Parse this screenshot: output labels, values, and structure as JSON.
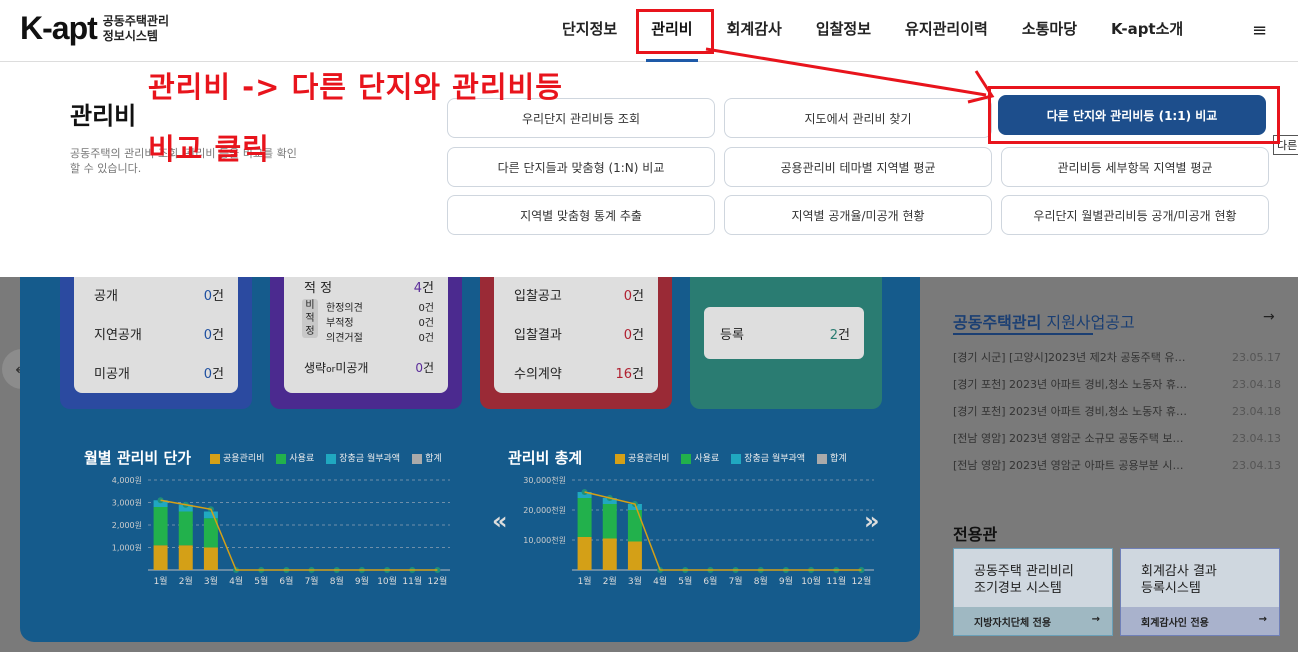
{
  "header": {
    "logo_main": "K-apt",
    "logo_sub1": "공동주택관리",
    "logo_sub2": "정보시스템",
    "nav": [
      "단지정보",
      "관리비",
      "회계감사",
      "입찰정보",
      "유지관리이력",
      "소통마당",
      "K-apt소개"
    ],
    "menu_icon": "≡"
  },
  "mega_menu": {
    "title": "관리비",
    "description": "공동주택의 관리비 조회, 관리비 등을 비교를 확인 할 수 있습니다.",
    "buttons": [
      "우리단지 관리비등 조회",
      "지도에서 관리비 찾기",
      "다른 단지와 관리비등 (1:1) 비교",
      "다른 단지들과 맞춤형 (1:N) 비교",
      "공용관리비 테마별 지역별 평균",
      "관리비등 세부항목 지역별 평균",
      "지역별 맞춤형 통계 추출",
      "지역별 공개율/미공개 현황",
      "우리단지 월별관리비등 공개/미공개 현황"
    ],
    "tooltip": "다른"
  },
  "annotation": {
    "line1": "관리비 -> 다른 단지와 관리비등",
    "line2": "비교 클릭",
    "color": "#e8141c"
  },
  "cards": {
    "disclosure": [
      {
        "label": "공개",
        "value": "0",
        "unit": "건"
      },
      {
        "label": "지연공개",
        "value": "0",
        "unit": "건"
      },
      {
        "label": "미공개",
        "value": "0",
        "unit": "건"
      }
    ],
    "audit": {
      "top_label": "적 정",
      "top_value": "4",
      "unit": "건",
      "side_label": [
        "비",
        "적",
        "정"
      ],
      "sub": [
        {
          "label": "한정의견",
          "value": "0건"
        },
        {
          "label": "부적정",
          "value": "0건"
        },
        {
          "label": "의견거절",
          "value": "0건"
        }
      ],
      "bottom_label_1": "생략",
      "bottom_label_or": "or",
      "bottom_label_2": "미공개",
      "bottom_value": "0"
    },
    "bidding": [
      {
        "label": "입찰공고",
        "value": "0",
        "unit": "건"
      },
      {
        "label": "입찰결과",
        "value": "0",
        "unit": "건"
      },
      {
        "label": "수의계약",
        "value": "16",
        "unit": "건"
      }
    ],
    "maintenance": {
      "label": "등록",
      "value": "2",
      "unit": "건"
    }
  },
  "charts": {
    "unit_title": "월별 관리비 단가",
    "total_title": "관리비 총계",
    "legend": [
      "공용관리비",
      "사용료",
      "장충금 월부과액",
      "합계"
    ],
    "legend_colors": [
      "#d4a017",
      "#22b14c",
      "#20a8c0",
      "#aaaaaa"
    ],
    "prev": "«",
    "next": "»"
  },
  "chart_data": [
    {
      "type": "bar",
      "title": "월별 관리비 단가",
      "categories": [
        "1월",
        "2월",
        "3월",
        "4월",
        "5월",
        "6월",
        "7월",
        "8월",
        "9월",
        "10월",
        "11월",
        "12월"
      ],
      "yticks": [
        "4,000원",
        "3,000원",
        "2,000원",
        "1,000원"
      ],
      "ylim": [
        0,
        4000
      ],
      "series": [
        {
          "name": "공용관리비",
          "values": [
            1100,
            1100,
            1000,
            0,
            0,
            0,
            0,
            0,
            0,
            0,
            0,
            0
          ]
        },
        {
          "name": "사용료",
          "values": [
            1700,
            1500,
            1300,
            0,
            0,
            0,
            0,
            0,
            0,
            0,
            0,
            0
          ]
        },
        {
          "name": "장충금 월부과액",
          "values": [
            300,
            300,
            300,
            0,
            0,
            0,
            0,
            0,
            0,
            0,
            0,
            0
          ]
        },
        {
          "name": "합계",
          "values": [
            3100,
            2900,
            2700,
            0,
            0,
            0,
            0,
            0,
            0,
            0,
            0,
            0
          ]
        }
      ]
    },
    {
      "type": "bar",
      "title": "관리비 총계",
      "categories": [
        "1월",
        "2월",
        "3월",
        "4월",
        "5월",
        "6월",
        "7월",
        "8월",
        "9월",
        "10월",
        "11월",
        "12월"
      ],
      "yticks": [
        "30,000천원",
        "20,000천원",
        "10,000천원"
      ],
      "ylim": [
        0,
        30000
      ],
      "series": [
        {
          "name": "공용관리비",
          "values": [
            11000,
            10500,
            9500,
            0,
            0,
            0,
            0,
            0,
            0,
            0,
            0,
            0
          ]
        },
        {
          "name": "사용료",
          "values": [
            13000,
            11500,
            10500,
            0,
            0,
            0,
            0,
            0,
            0,
            0,
            0,
            0
          ]
        },
        {
          "name": "장충금 월부과액",
          "values": [
            2000,
            2000,
            2000,
            0,
            0,
            0,
            0,
            0,
            0,
            0,
            0,
            0
          ]
        },
        {
          "name": "합계",
          "values": [
            26000,
            24000,
            22000,
            0,
            0,
            0,
            0,
            0,
            0,
            0,
            0,
            0
          ]
        }
      ]
    }
  ],
  "side": {
    "notice_title_bold": "공동주택관리",
    "notice_title": " 지원사업공고",
    "notice_arrow": "→",
    "notices": [
      {
        "text": "[경기 시군] [고양시]2023년 제2차 공동주택 유…",
        "date": "23.05.17"
      },
      {
        "text": "[경기 포천] 2023년 아파트 경비,청소 노동자 휴…",
        "date": "23.04.18"
      },
      {
        "text": "[경기 포천] 2023년 아파트 경비,청소 노동자 휴…",
        "date": "23.04.18"
      },
      {
        "text": "[전남 영암] 2023년 영암군 소규모 공동주택 보…",
        "date": "23.04.13"
      },
      {
        "text": "[전남 영암] 2023년 영암군 아파트 공용부분 시…",
        "date": "23.04.13"
      }
    ],
    "dedicated_title": "전용관",
    "box1_line1": "공동주택 관리비리",
    "box1_line2": "조기경보 시스템",
    "box1_foot": "지방자치단체 전용",
    "box2_line1": "회계감사 결과",
    "box2_line2": "등록시스템",
    "box2_foot": "회계감사인 전용",
    "arrow": "→"
  },
  "left_arrow": "←"
}
